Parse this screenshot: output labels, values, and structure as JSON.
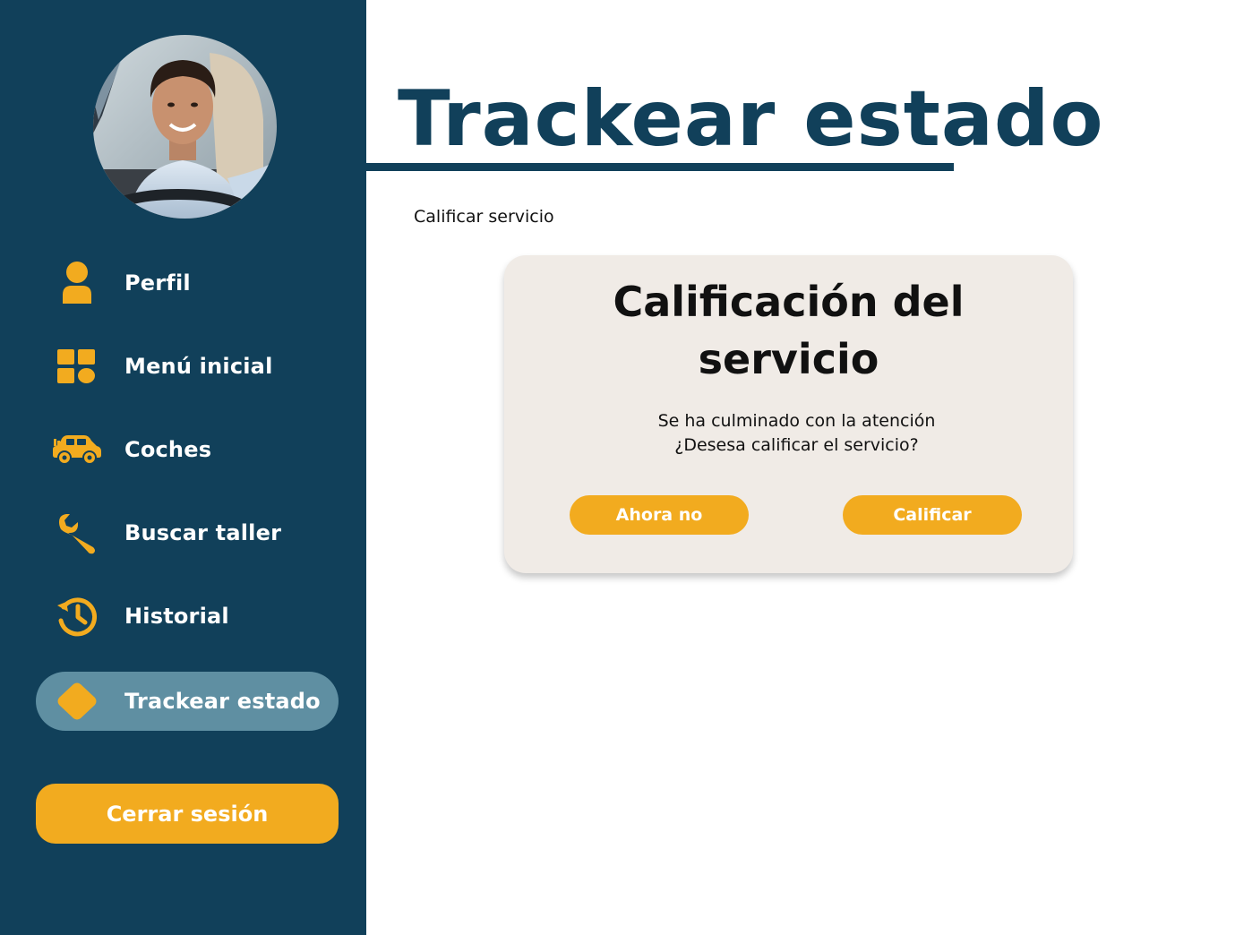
{
  "sidebar": {
    "items": [
      {
        "label": "Perfil",
        "icon": "person-icon"
      },
      {
        "label": "Menú inicial",
        "icon": "grid-icon"
      },
      {
        "label": "Coches",
        "icon": "car-icon"
      },
      {
        "label": "Buscar taller",
        "icon": "wrench-icon"
      },
      {
        "label": "Historial",
        "icon": "history-icon"
      },
      {
        "label": "Trackear estado",
        "icon": "diamond-icon",
        "active": true
      }
    ],
    "logout_label": "Cerrar sesión"
  },
  "header": {
    "title": "Trackear estado"
  },
  "main": {
    "section_label": "Calificar servicio",
    "dialog": {
      "title_line1": "Calificación del",
      "title_line2": "servicio",
      "message_line1": "Se ha culminado con la atención",
      "message_line2": "¿Desesa calificar el servicio?",
      "decline_label": "Ahora no",
      "confirm_label": "Calificar"
    }
  },
  "colors": {
    "sidebar_bg": "#11405a",
    "accent": "#f2ab1f",
    "active_item_bg": "#5f8fa2",
    "dialog_bg": "#f0ebe6"
  }
}
